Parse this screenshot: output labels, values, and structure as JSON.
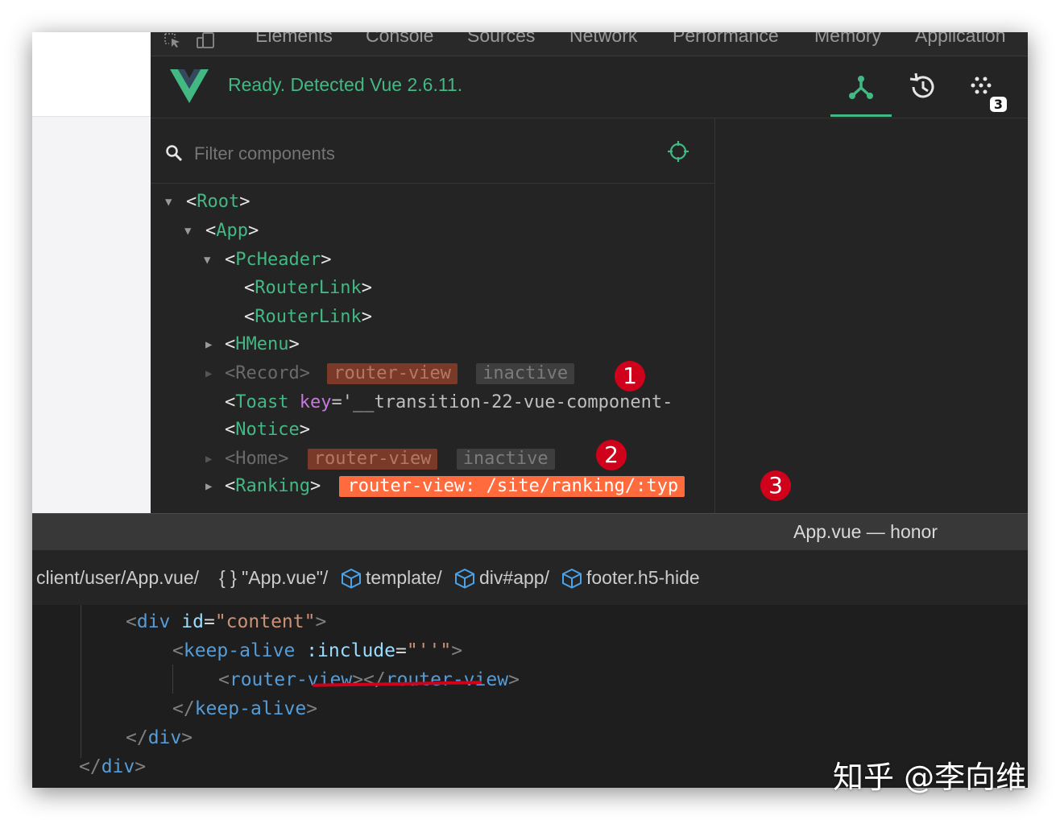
{
  "devtools_tabs": [
    "Elements",
    "Console",
    "Sources",
    "Network",
    "Performance",
    "Memory",
    "Application"
  ],
  "vue_status": "Ready. Detected Vue 2.6.11.",
  "timeline_badge": "3",
  "filter_placeholder": "Filter components",
  "tree": {
    "root": "Root",
    "app": "App",
    "pcheader": "PcHeader",
    "routerlink1": "RouterLink",
    "routerlink2": "RouterLink",
    "hmenu": "HMenu",
    "record": "Record",
    "record_chip1": "router-view",
    "record_chip2": "inactive",
    "toast_name": "Toast",
    "toast_attr": "key",
    "toast_value": "='__transition-22-vue-component-",
    "notice": "Notice",
    "home": "Home",
    "home_chip1": "router-view",
    "home_chip2": "inactive",
    "ranking": "Ranking",
    "ranking_chip": "router-view: /site/ranking/:typ"
  },
  "markers": [
    "1",
    "2",
    "3"
  ],
  "editor": {
    "title": "App.vue — honor",
    "breadcrumb": [
      "client/user/App.vue/",
      "{ } \"App.vue\"/",
      "template/",
      "div#app/",
      "footer.h5-hide"
    ],
    "lines": [
      {
        "tag": "div",
        "attr": "id",
        "value": "\"content\""
      },
      {
        "tag": "keep-alive",
        "attr": ":include",
        "value": "\"''\""
      },
      {
        "tag": "router-view",
        "close": "router-view"
      },
      {
        "close": "keep-alive"
      },
      {
        "close": "div"
      },
      {
        "close": "div"
      }
    ]
  },
  "watermark": "知乎 @李向维",
  "colors": {
    "vue_green": "#42b883",
    "chip_active": "#ff6b3d",
    "marker_red": "#d0021b"
  }
}
